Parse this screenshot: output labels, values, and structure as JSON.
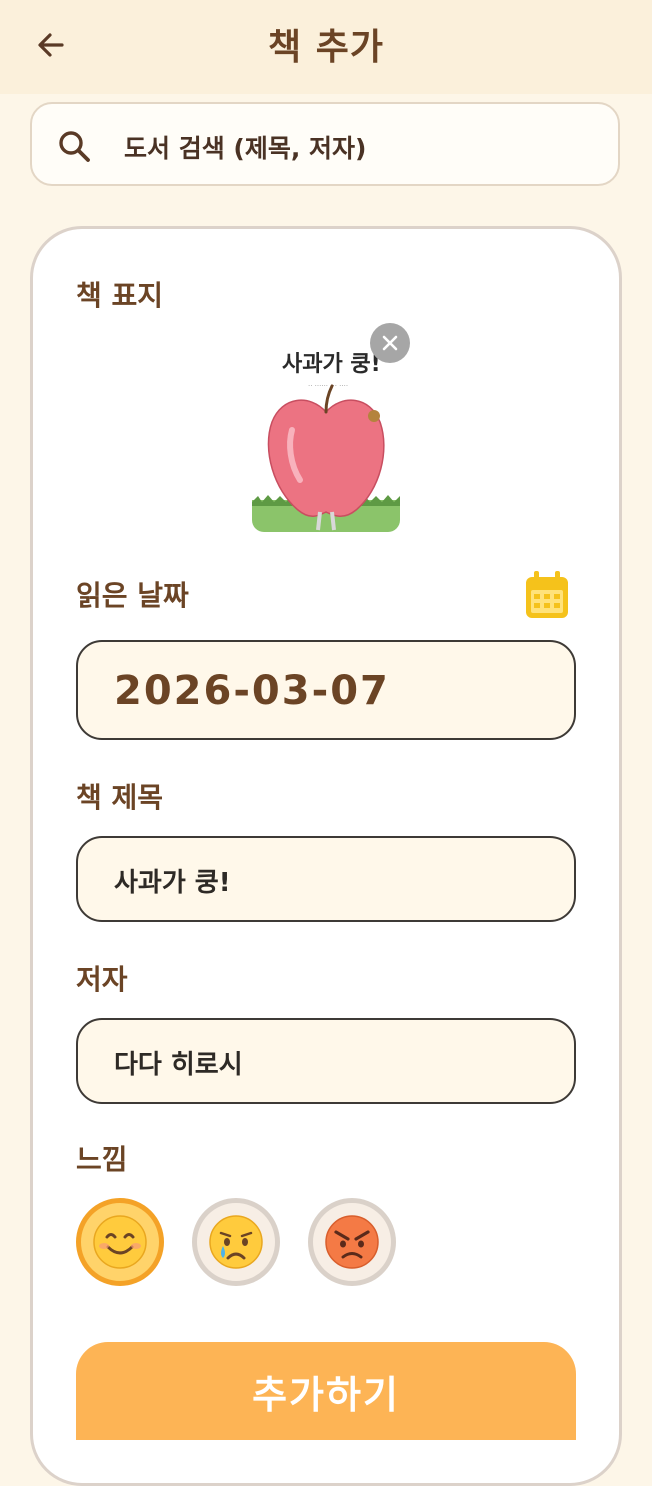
{
  "header": {
    "title": "책 추가",
    "back_icon": "arrow-left-icon"
  },
  "search": {
    "placeholder": "도서 검색 (제목, 저자)",
    "icon": "search-icon"
  },
  "form": {
    "cover_label": "책 표지",
    "cover_book_title": "사과가 쿵!",
    "date_label": "읽은 날짜",
    "date_value": "2026-03-07",
    "title_label": "책 제목",
    "title_value": "사과가 쿵!",
    "author_label": "저자",
    "author_value": "다다 히로시",
    "feeling_label": "느낌",
    "moods": [
      {
        "emoji": "😊",
        "name": "happy",
        "selected": true
      },
      {
        "emoji": "😢",
        "name": "sad",
        "selected": false
      },
      {
        "emoji": "😡",
        "name": "angry",
        "selected": false
      }
    ],
    "submit_label": "추가하기"
  },
  "colors": {
    "background": "#FDF6E8",
    "header_bg": "#FBF0DB",
    "accent": "#FDB455",
    "text_brown": "#6B4425",
    "calendar": "#F5C21B"
  }
}
